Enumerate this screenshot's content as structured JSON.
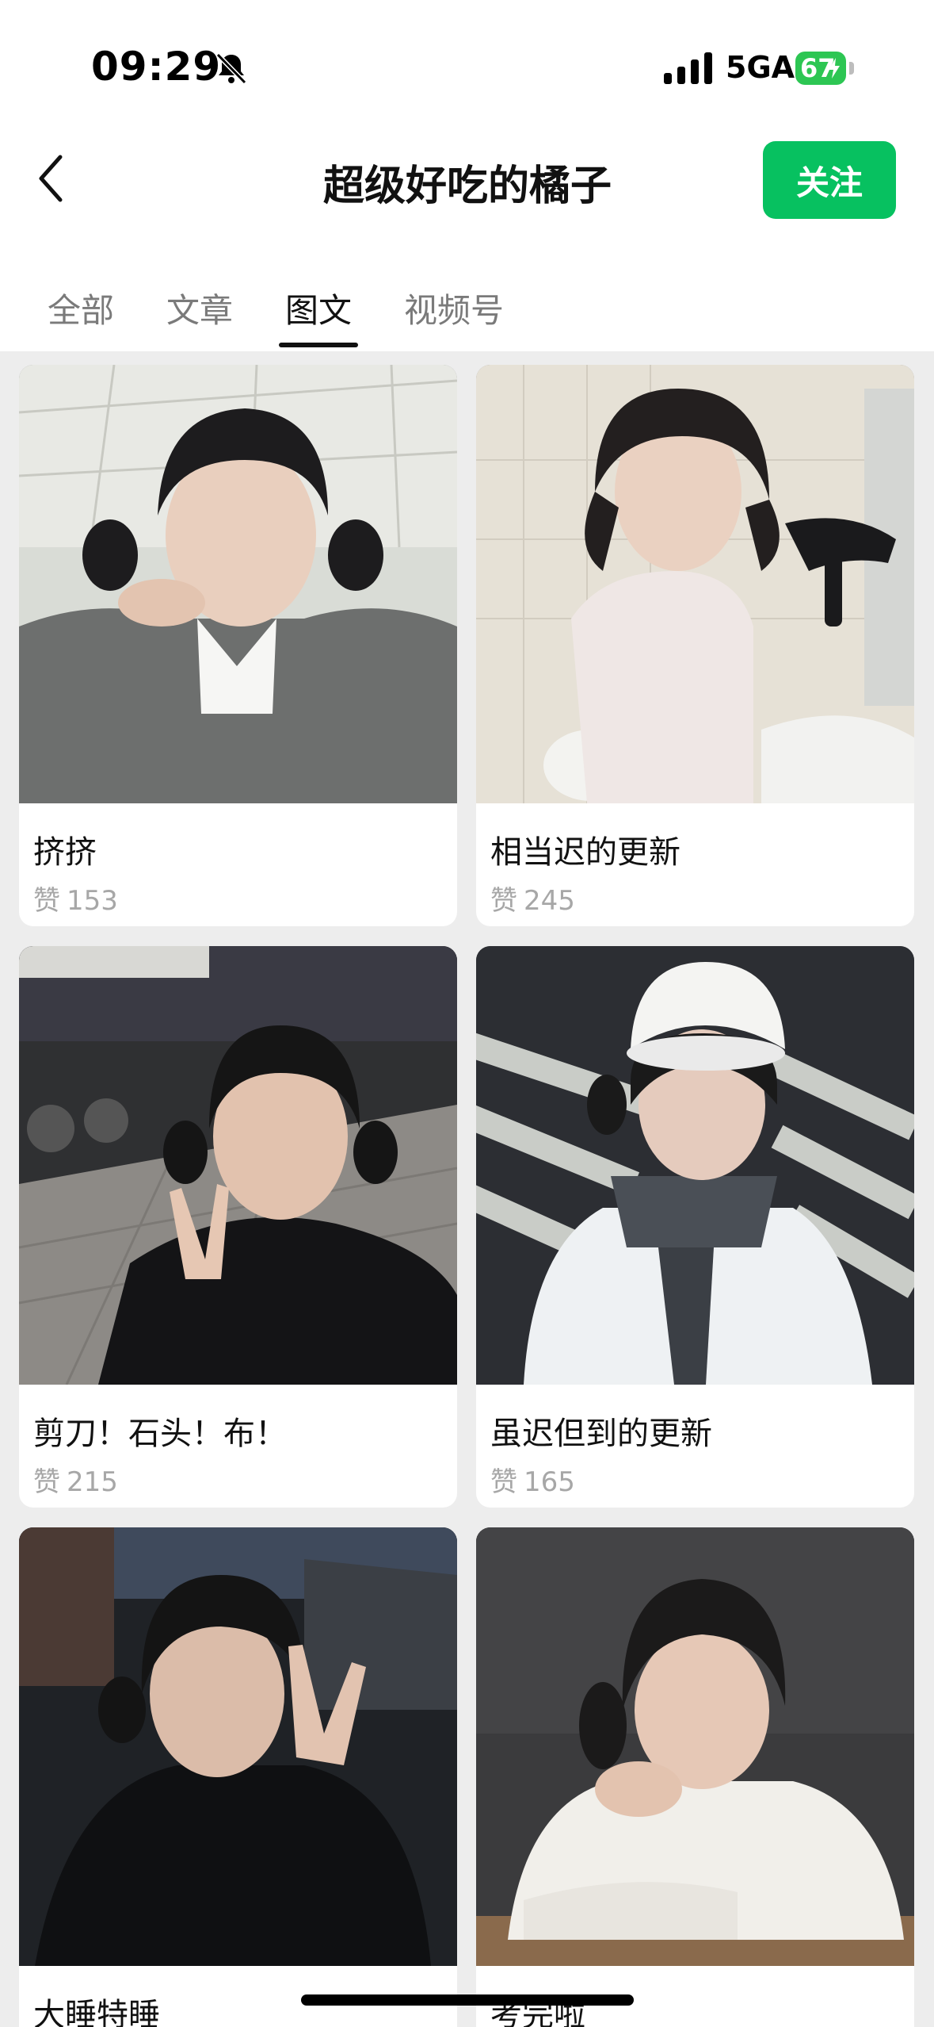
{
  "status": {
    "time": "09:29",
    "network": "5GA",
    "battery": "67"
  },
  "header": {
    "title": "超级好吃的橘子",
    "follow_label": "关注"
  },
  "tabs": [
    {
      "label": "全部",
      "active": false
    },
    {
      "label": "文章",
      "active": false
    },
    {
      "label": "图文",
      "active": true
    },
    {
      "label": "视频号",
      "active": false
    }
  ],
  "likes_label": "赞",
  "posts": [
    {
      "title": "挤挤",
      "likes": "153"
    },
    {
      "title": "相当迟的更新",
      "likes": "245"
    },
    {
      "title": "剪刀！石头！布！",
      "likes": "215"
    },
    {
      "title": "虽迟但到的更新",
      "likes": "165"
    },
    {
      "title": "大睡特睡",
      "likes": ""
    },
    {
      "title": "考完啦",
      "likes": ""
    }
  ],
  "colors": {
    "accent": "#07c160",
    "battery": "#2dc653",
    "page_bg": "#ededed"
  }
}
